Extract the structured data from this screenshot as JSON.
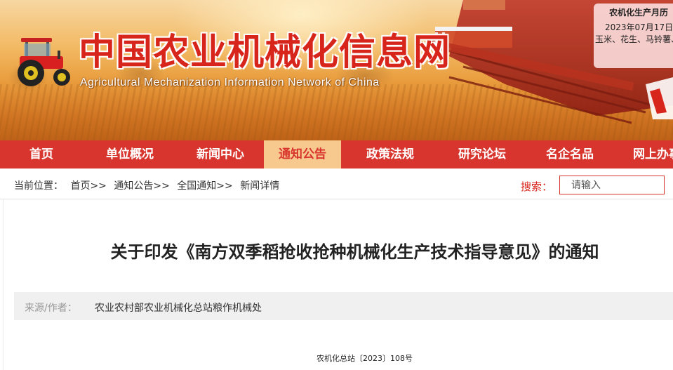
{
  "header": {
    "title": "中国农业机械化信息网",
    "subtitle": "Agricultural Mechanization Information Network of China",
    "calendar": {
      "title": "农机化生产月历",
      "date": "2023年07月17日",
      "crops": "玉米、花生、马铃薯、"
    }
  },
  "nav": {
    "items": [
      {
        "label": "首页"
      },
      {
        "label": "单位概况"
      },
      {
        "label": "新闻中心"
      },
      {
        "label": "通知公告"
      },
      {
        "label": "政策法规"
      },
      {
        "label": "研究论坛"
      },
      {
        "label": "名企名品"
      },
      {
        "label": "网上办事"
      }
    ],
    "active_index": 3
  },
  "breadcrumb": {
    "prefix": "当前位置：",
    "items": [
      "首页>>",
      "通知公告>>",
      "全国通知>>",
      "新闻详情"
    ]
  },
  "search": {
    "label": "搜索：",
    "placeholder": "请输入"
  },
  "article": {
    "title": "关于印发《南方双季稻抢收抢种机械化生产技术指导意见》的通知",
    "source_label": "来源/作者：",
    "source_value": "农业农村部农业机械化总站粮作机械处",
    "doc_number": "农机化总站〔2023〕108号"
  },
  "colors": {
    "brand_red": "#d8352e",
    "title_red": "#d8251c",
    "active_tab_bg": "#f7c98e"
  }
}
